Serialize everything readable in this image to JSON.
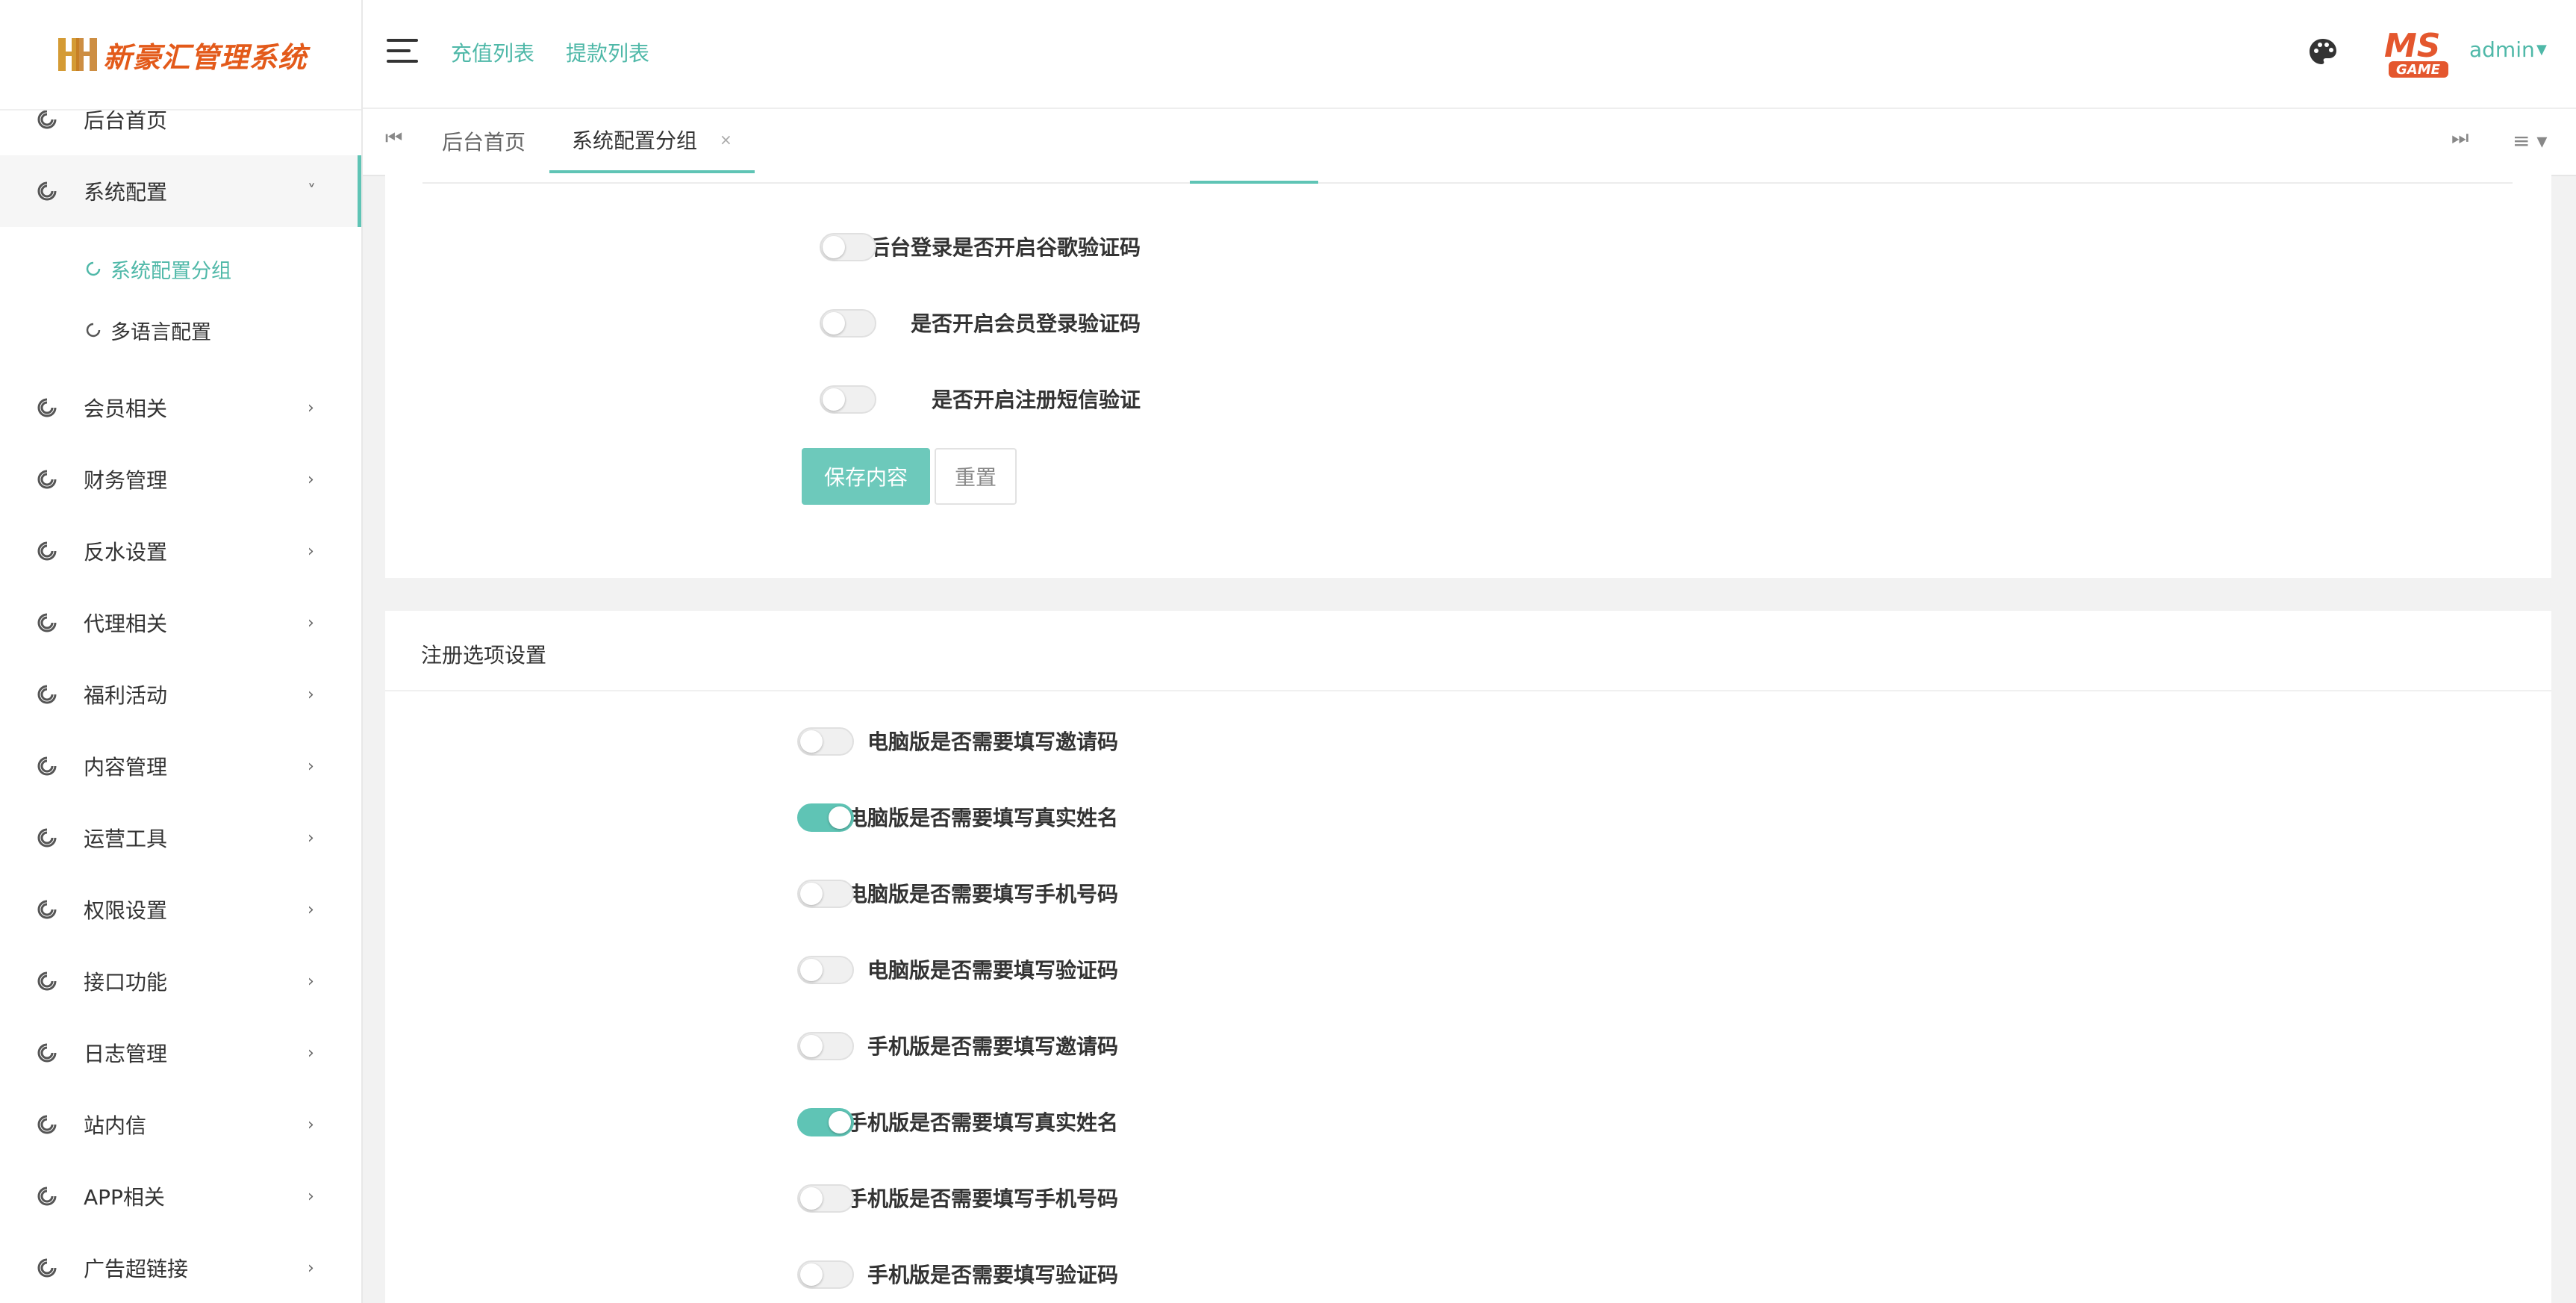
{
  "app": {
    "title": "新豪汇管理系统",
    "accent": "#5fc4b5"
  },
  "header": {
    "links": [
      "充值列表",
      "提款列表"
    ],
    "user": "admin",
    "avatar_text": "MS GAME"
  },
  "sidebar": {
    "items": [
      {
        "label": "后台首页"
      },
      {
        "label": "系统配置",
        "open": true,
        "children": [
          {
            "label": "系统配置分组",
            "active": true
          },
          {
            "label": "多语言配置"
          }
        ]
      },
      {
        "label": "会员相关"
      },
      {
        "label": "财务管理"
      },
      {
        "label": "反水设置"
      },
      {
        "label": "代理相关"
      },
      {
        "label": "福利活动"
      },
      {
        "label": "内容管理"
      },
      {
        "label": "运营工具"
      },
      {
        "label": "权限设置"
      },
      {
        "label": "接口功能"
      },
      {
        "label": "日志管理"
      },
      {
        "label": "站内信"
      },
      {
        "label": "APP相关"
      },
      {
        "label": "广告超链接"
      }
    ]
  },
  "tabs": {
    "items": [
      {
        "label": "后台首页"
      },
      {
        "label": "系统配置分组",
        "active": true,
        "close": "×"
      }
    ]
  },
  "section1": {
    "rows": [
      {
        "label": "后台登录是否开启谷歌验证码",
        "on": false
      },
      {
        "label": "是否开启会员登录验证码",
        "on": false
      },
      {
        "label": "是否开启注册短信验证",
        "on": false
      }
    ],
    "save_label": "保存内容",
    "reset_label": "重置"
  },
  "section2": {
    "title": "注册选项设置",
    "rows": [
      {
        "label": "电脑版是否需要填写邀请码",
        "on": false
      },
      {
        "label": "电脑版是否需要填写真实姓名",
        "on": true
      },
      {
        "label": "电脑版是否需要填写手机号码",
        "on": false
      },
      {
        "label": "电脑版是否需要填写验证码",
        "on": false
      },
      {
        "label": "手机版是否需要填写邀请码",
        "on": false
      },
      {
        "label": "手机版是否需要填写真实姓名",
        "on": true
      },
      {
        "label": "手机版是否需要填写手机号码",
        "on": false
      },
      {
        "label": "手机版是否需要填写验证码",
        "on": false
      }
    ]
  }
}
